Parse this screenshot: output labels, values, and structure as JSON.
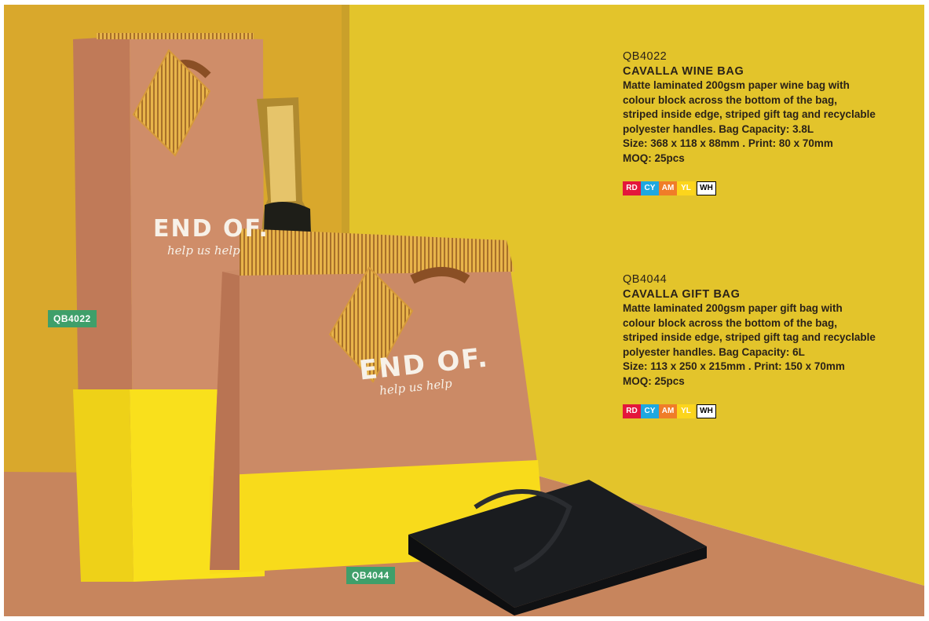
{
  "bag_print": {
    "brand": "END OF.",
    "script": "help us help"
  },
  "labels": {
    "wine_code": "QB4022",
    "gift_code": "QB4044"
  },
  "products": [
    {
      "code": "QB4022",
      "name": "CAVALLA WINE BAG",
      "lines": [
        "Matte laminated 200gsm paper wine bag with",
        "colour block across the bottom of the bag,",
        "striped inside edge, striped gift tag and recyclable",
        "polyester handles. Bag Capacity: 3.8L",
        "Size: 368 x 118 x 88mm . Print: 80 x 70mm",
        "MOQ: 25pcs"
      ],
      "swatches": [
        "RD",
        "CY",
        "AM",
        "YL",
        "WH"
      ]
    },
    {
      "code": "QB4044",
      "name": "CAVALLA GIFT BAG",
      "lines": [
        "Matte laminated 200gsm paper gift bag with",
        "colour block across the bottom of the bag,",
        "striped inside edge, striped gift tag and recyclable",
        "polyester handles. Bag Capacity: 6L",
        "Size: 113 x 250 x 215mm . Print: 150 x 70mm",
        "MOQ: 25pcs"
      ],
      "swatches": [
        "RD",
        "CY",
        "AM",
        "YL",
        "WH"
      ]
    }
  ],
  "colors": {
    "RD": "#e4173b",
    "CY": "#1ea8e0",
    "AM": "#f07d28",
    "YL": "#fcd51c",
    "WH": "#ffffff",
    "wall": "#e0b82a",
    "floor": "#c8865e",
    "bag": "#c98a68",
    "bag_bottom": "#f7dc1c",
    "label_green": "#3f9f6a"
  }
}
